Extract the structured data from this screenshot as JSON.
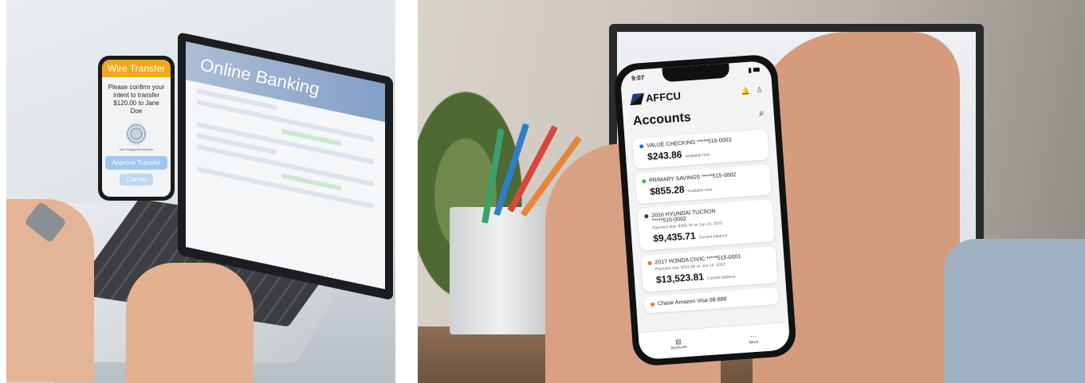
{
  "left_photo": {
    "laptop_screen": {
      "header": "Online Banking"
    },
    "phone": {
      "header": "Wire Transfer",
      "message": "Please confirm your intent to transfer $120.00 to Jane Doe",
      "fingerprint_label": "Use Fingerprint scanner",
      "approve_label": "Approve Transfer",
      "cancel_label": "Cancel",
      "header_color": "#f0a81e",
      "button_color": "#9ec7f0"
    }
  },
  "right_photo": {
    "phone": {
      "status_time": "9:07",
      "brand": "AFFCU",
      "title": "Accounts",
      "accounts": [
        {
          "name": "VALUE CHECKING *****515-0003",
          "balance": "$243.86",
          "balance_label": "Available now",
          "dot_color": "#1e6fd9"
        },
        {
          "name": "PRIMARY SAVINGS *****515-0002",
          "balance": "$855.28",
          "balance_label": "Available now",
          "dot_color": "#3bb34a"
        },
        {
          "name": "2016 HYUNDAI TUCSON",
          "number": "*****515-0002",
          "sub": "Payment due: $359.76 on Jun 14, 2022",
          "balance": "$9,435.71",
          "balance_label": "Current balance",
          "dot_color": "#1e3c78"
        },
        {
          "name": "2017 HONDA CIVIC *****515-0001",
          "sub": "Payment due: $501.68 on Jun 14, 2022",
          "balance": "$13,523.81",
          "balance_label": "Current balance",
          "dot_color": "#e8752a"
        },
        {
          "name": "Chase Amazon Visa 08-888",
          "dot_color": "#e8752a"
        }
      ],
      "tabs": [
        {
          "label": "Accounts",
          "icon": "accounts-icon"
        },
        {
          "label": "More",
          "icon": "more-icon"
        }
      ]
    }
  }
}
